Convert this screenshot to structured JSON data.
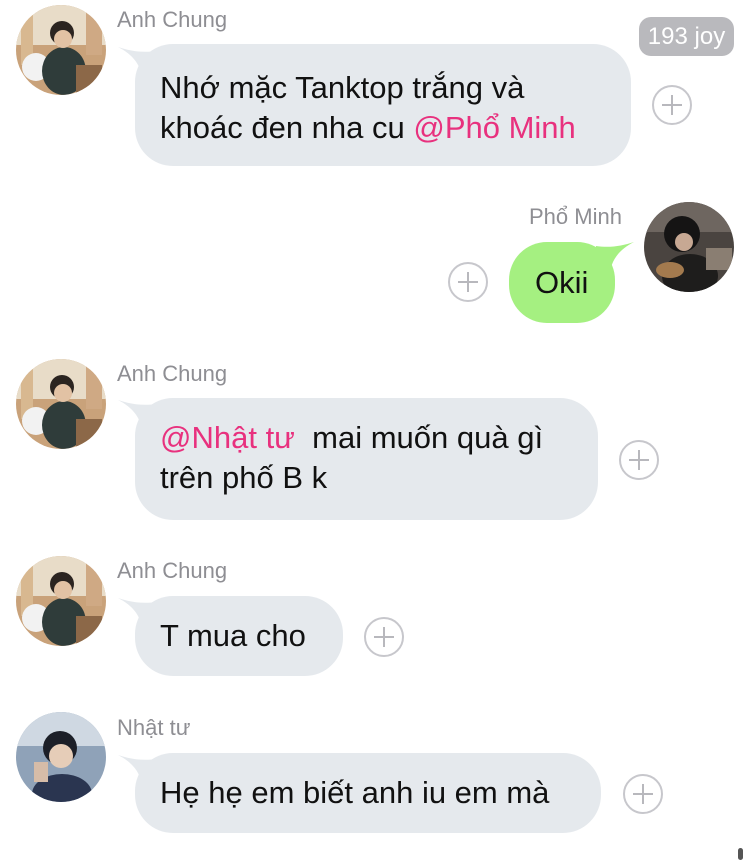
{
  "reaction_badge": {
    "count": "193",
    "label": "joy"
  },
  "messages": [
    {
      "sender": "Anh Chung",
      "lines": [
        [
          "Nhớ mặc Tanktop trắng và"
        ],
        [
          "khoác đen nha cu ",
          "@Phổ Minh"
        ]
      ],
      "direction": "incoming"
    },
    {
      "sender": "Phổ Minh",
      "lines": [
        [
          "Okii"
        ]
      ],
      "direction": "outgoing"
    },
    {
      "sender": "Anh Chung",
      "lines": [
        [
          "@Nhật tư",
          "  mai muốn quà gì"
        ],
        [
          "trên phố B k"
        ]
      ],
      "direction": "incoming"
    },
    {
      "sender": "Anh Chung",
      "lines": [
        [
          "T mua cho"
        ]
      ],
      "direction": "incoming"
    },
    {
      "sender": "Nhật tư",
      "lines": [
        [
          "Hẹ hẹ em biết anh iu em mà"
        ]
      ],
      "direction": "incoming"
    }
  ],
  "colors": {
    "incoming_bubble": "#e5e9ed",
    "outgoing_bubble": "#a5f081",
    "mention": "#e8317e",
    "sender_name": "#8e8e93"
  },
  "icons": {
    "reaction_button": "plus-circle-icon"
  }
}
